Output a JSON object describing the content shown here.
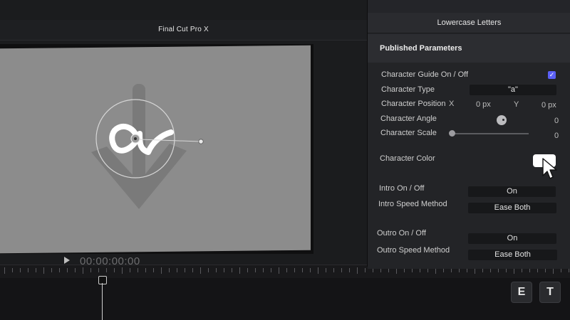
{
  "viewer": {
    "app_title": "Final Cut Pro X",
    "timecode": "00:00:00:00"
  },
  "inspector": {
    "title": "Lowercase Letters",
    "section_title": "Published Parameters",
    "params": {
      "guide_label": "Character Guide On / Off",
      "guide_checked": true,
      "type_label": "Character Type",
      "type_value": "\"a\"",
      "position_label": "Character Position",
      "pos_x_label": "X",
      "pos_x_value": "0 px",
      "pos_y_label": "Y",
      "pos_y_value": "0 px",
      "angle_label": "Character Angle",
      "angle_value": "0",
      "scale_label": "Character Scale",
      "scale_value": "0",
      "color_label": "Character Color",
      "color_value": "#ffffff",
      "intro_label": "Intro On / Off",
      "intro_value": "On",
      "intro_speed_label": "Intro Speed Method",
      "intro_speed_value": "Ease Both",
      "outro_label": "Outro On / Off",
      "outro_value": "On",
      "outro_speed_label": "Outro Speed Method",
      "outro_speed_value": "Ease Both"
    }
  },
  "timeline": {
    "key_buttons": [
      "E",
      "T"
    ]
  }
}
